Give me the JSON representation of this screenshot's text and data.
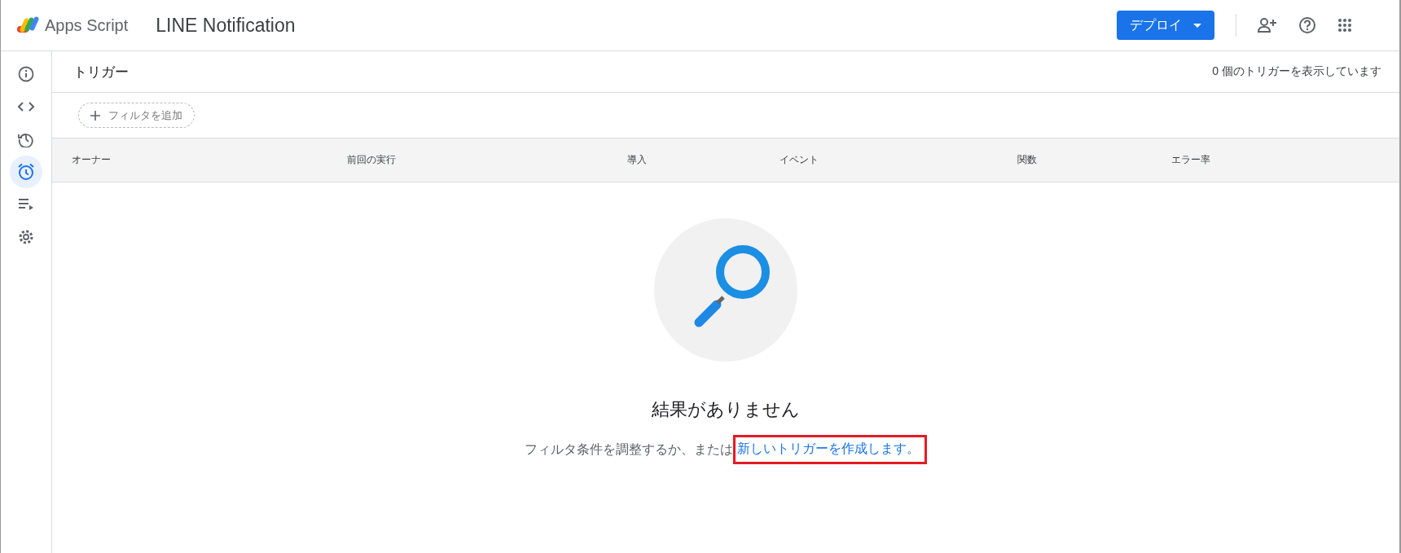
{
  "app": {
    "name": "Apps Script",
    "project": "LINE Notification"
  },
  "deploy_button": "デプロイ",
  "sidebar": {
    "items": [
      {
        "kind": "info",
        "selected": false
      },
      {
        "kind": "code",
        "selected": false
      },
      {
        "kind": "history",
        "selected": false
      },
      {
        "kind": "alarm",
        "selected": true
      },
      {
        "kind": "executions",
        "selected": false
      },
      {
        "kind": "settings",
        "selected": false
      }
    ]
  },
  "page": {
    "title": "トリガー",
    "count": "0 個のトリガーを表示しています",
    "filter_button": "フィルタを追加"
  },
  "table": {
    "columns": [
      "オーナー",
      "前回の実行",
      "導入",
      "イベント",
      "関数",
      "エラー率"
    ]
  },
  "empty": {
    "heading": "結果がありません",
    "text": "フィルタ条件を調整するか、または",
    "link": "新しいトリガーを作成します。"
  }
}
